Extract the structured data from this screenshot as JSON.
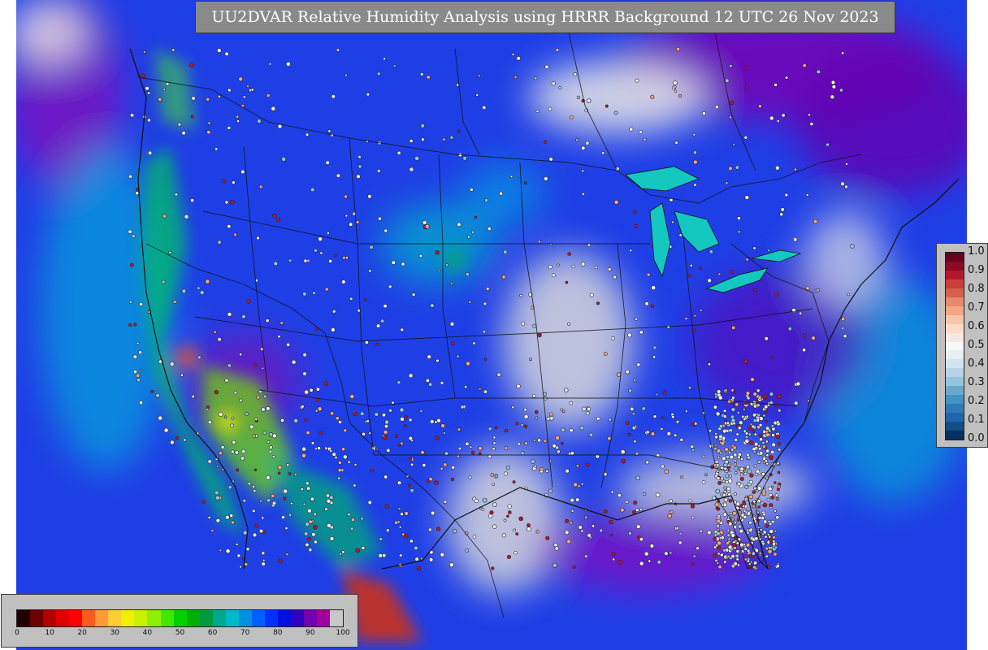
{
  "title": "UU2DVAR Relative Humidity Analysis using HRRR Background 12 UTC 26 Nov 2023",
  "rh_scale": {
    "ticks": [
      "0",
      "10",
      "20",
      "30",
      "40",
      "50",
      "60",
      "70",
      "80",
      "90",
      "100"
    ],
    "colors": [
      "#200000",
      "#6a0000",
      "#b00000",
      "#e00000",
      "#ff0000",
      "#ff5a1e",
      "#ff9a3a",
      "#ffcc33",
      "#f0f000",
      "#c8f000",
      "#8cf000",
      "#40e800",
      "#00d000",
      "#00b000",
      "#009a40",
      "#00a890",
      "#00b8c8",
      "#0090e0",
      "#0060ff",
      "#0030ff",
      "#0010e0",
      "#3000c0",
      "#7000b0",
      "#a000a0",
      "#c8c8c8"
    ]
  },
  "obs_scale": {
    "ticks": [
      "1.0",
      "0.9",
      "0.8",
      "0.7",
      "0.6",
      "0.5",
      "0.4",
      "0.3",
      "0.2",
      "0.1",
      "0.0"
    ],
    "colors": [
      "#67001f",
      "#8b0a26",
      "#b2182b",
      "#c9403a",
      "#d6604d",
      "#e58a6f",
      "#f4a582",
      "#f7c4ac",
      "#fddbc7",
      "#f5e9e3",
      "#f7f7f7",
      "#eaeef1",
      "#d1e5f0",
      "#b7d3e5",
      "#92c5de",
      "#6aa8cb",
      "#4393c3",
      "#3179b4",
      "#2166ac",
      "#154d85",
      "#053061"
    ]
  }
}
